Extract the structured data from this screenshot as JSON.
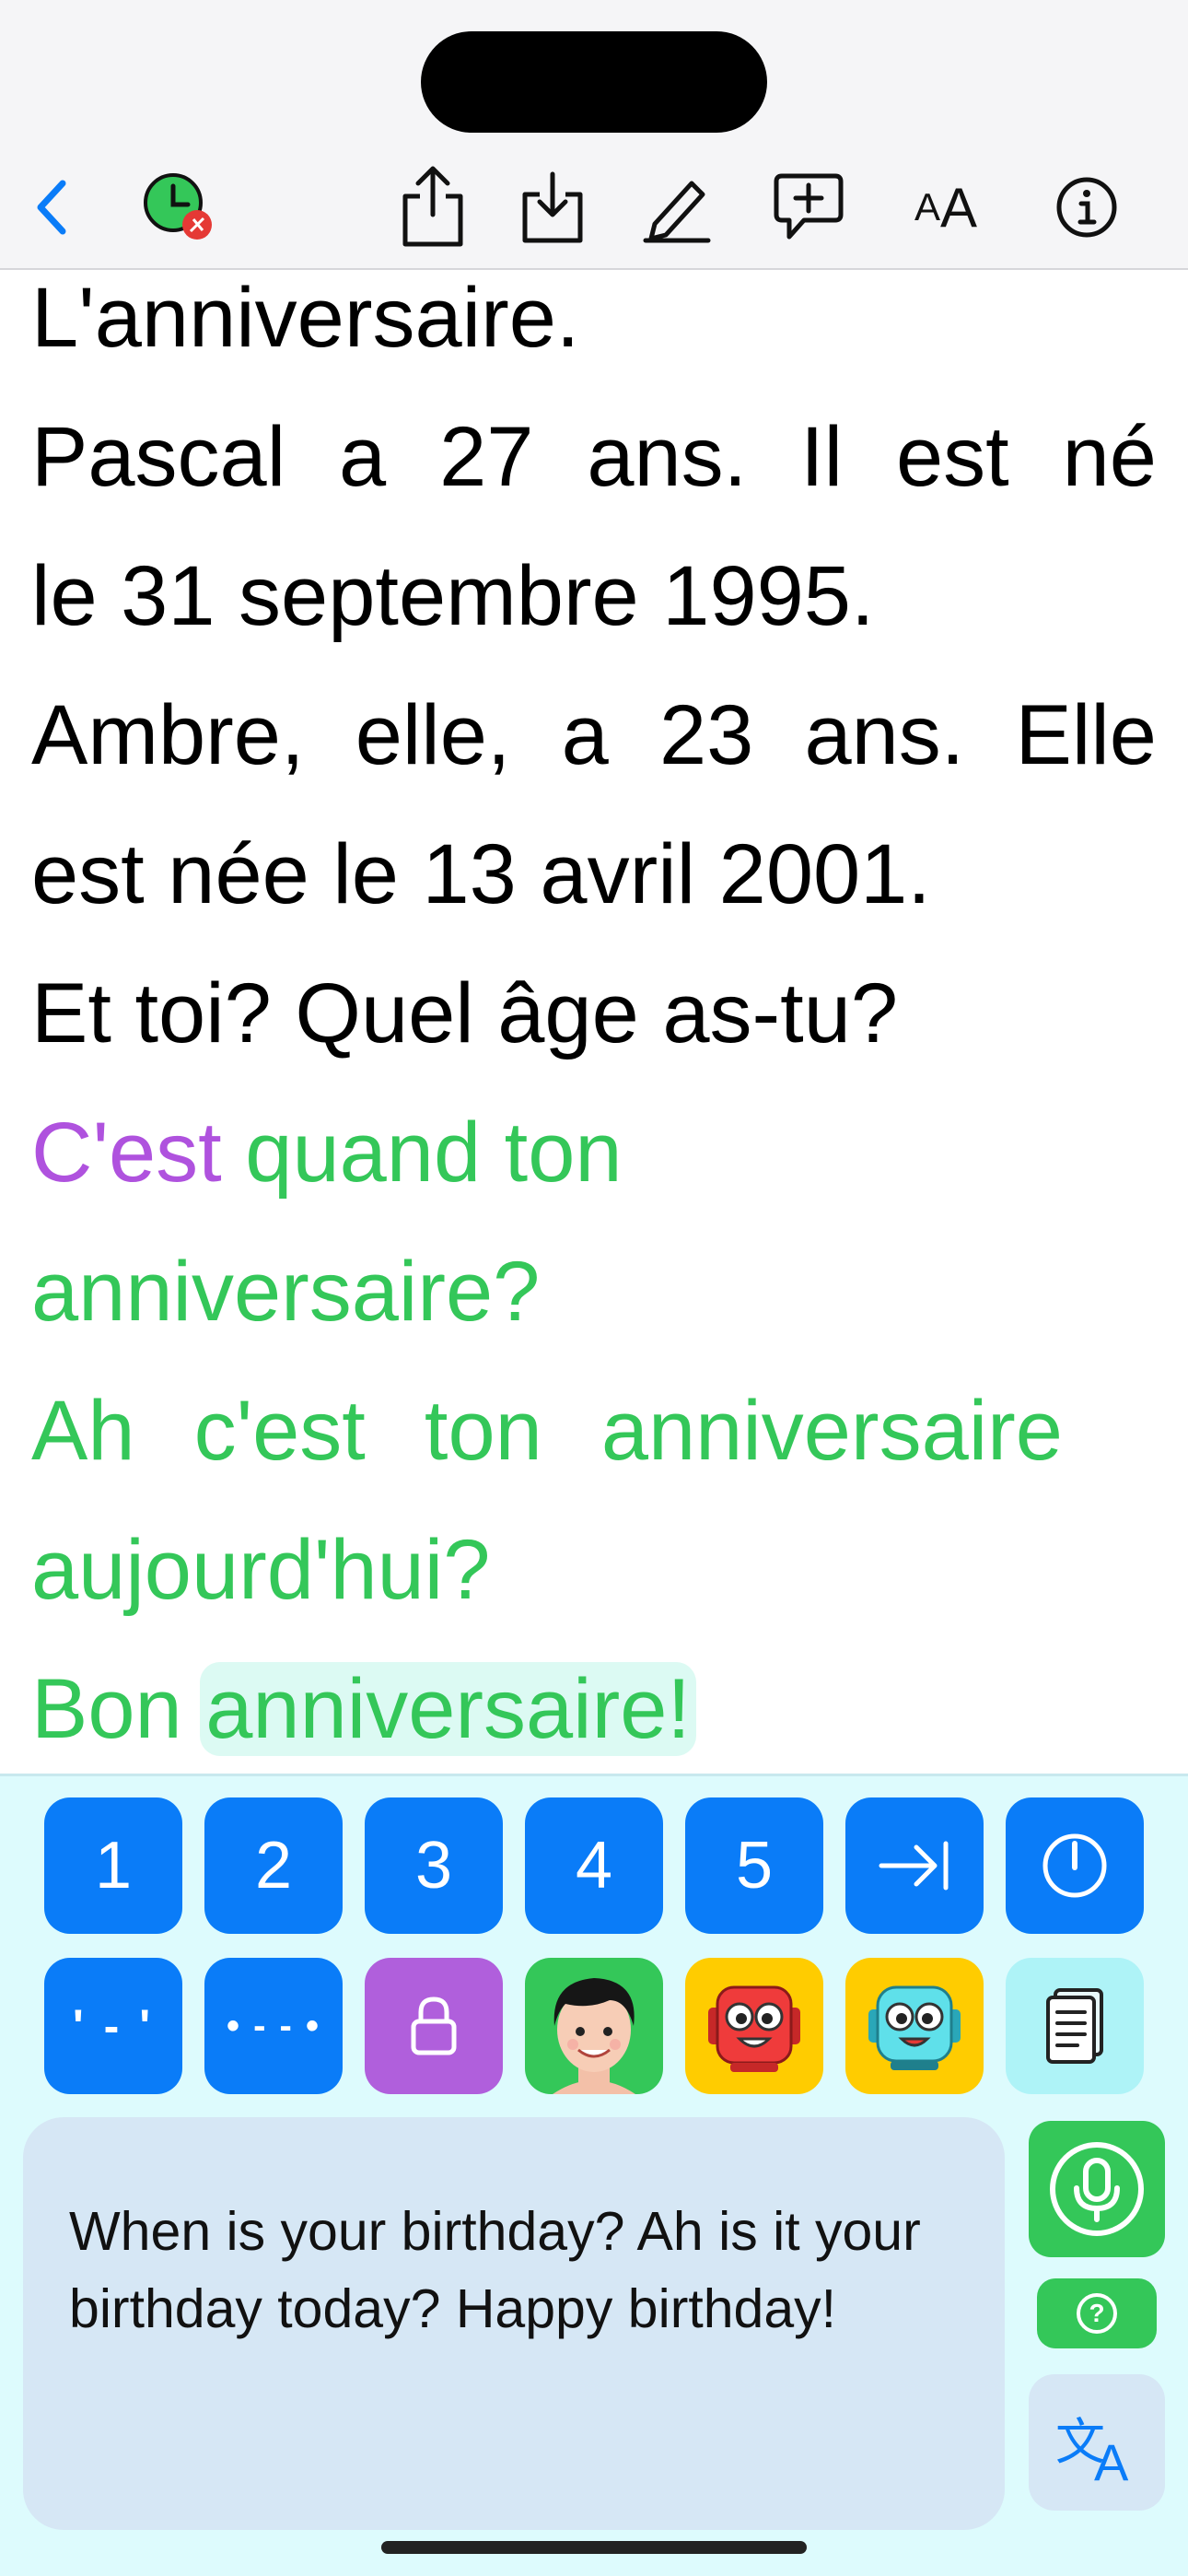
{
  "toolbar": {
    "icons": [
      "back-icon",
      "timer-badge-icon",
      "share-icon",
      "download-icon",
      "pencil-icon",
      "add-comment-icon",
      "text-size-icon",
      "info-icon"
    ],
    "text_size_label": "AA",
    "accent": "#0a7cf8"
  },
  "reader": {
    "lines": [
      "L'anniversaire.",
      [
        "Pascal",
        "a",
        "27",
        "ans.",
        "Il",
        "est",
        "né"
      ],
      "le 31 septembre 1995.",
      [
        "Ambre,",
        "elle,",
        "a",
        "23",
        "ans.",
        "Elle"
      ],
      "est née le 13 avril 2001.",
      "Et toi? Quel âge as-tu?"
    ],
    "q1_purple": "C'est",
    "q1_green": " quand ton",
    "q1_line2": "anniversaire?",
    "q2_line1": [
      "Ah",
      "c'est",
      "ton",
      "anniversaire"
    ],
    "q2_line2": "aujourd'hui?",
    "q3_start": "Bon ",
    "q3_highlight": "anniversaire!",
    "colors": {
      "green": "#34c759",
      "purple": "#af52de",
      "highlight": "#dcfaf3"
    }
  },
  "keys": {
    "row1": [
      "1",
      "2",
      "3",
      "4",
      "5"
    ],
    "row1_icons": [
      "skip-to-end-icon",
      "speed-gauge-icon"
    ],
    "row2_icons": [
      "pause-pattern-icon",
      "dots-pattern-icon",
      "lock-icon",
      "avatar-man-icon",
      "red-robot-icon",
      "cyan-robot-icon",
      "transcript-icon"
    ],
    "pattern1": "' - '",
    "pattern2": "• - - •"
  },
  "translation": {
    "text": "When is your birthday? Ah is it your birthday today? Happy birthday!"
  },
  "actions": {
    "icons": [
      "microphone-icon",
      "help-icon",
      "translate-icon"
    ],
    "help_label": "?",
    "translate_glyph_1": "文",
    "translate_glyph_2": "A"
  }
}
